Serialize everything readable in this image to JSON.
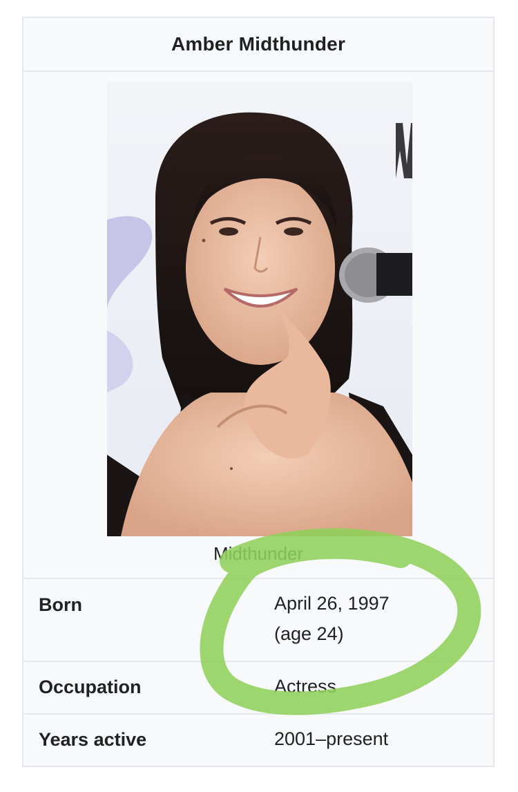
{
  "infobox": {
    "title": "Amber Midthunder",
    "caption": "Midthunder",
    "rows": [
      {
        "label": "Born",
        "value_line1": "April 26, 1997",
        "value_line2": "(age 24)"
      },
      {
        "label": "Occupation",
        "value": "Actress"
      },
      {
        "label": "Years active",
        "value": "2001–present"
      }
    ]
  },
  "annotation": {
    "type": "hand-drawn-ellipse",
    "color": "#8fd05a"
  },
  "colors": {
    "border": "#e6e7ea",
    "background": "#f8f9fa",
    "text": "#202122"
  }
}
